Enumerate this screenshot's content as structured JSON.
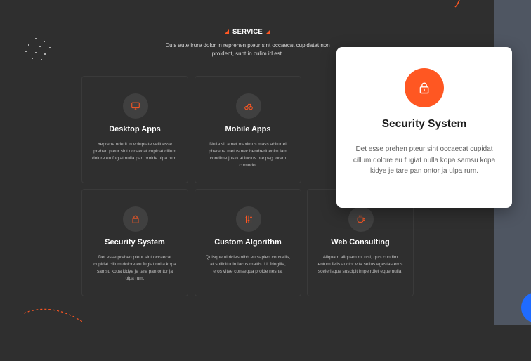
{
  "section": {
    "tag": "SERVICE",
    "intro": "Duis aute irure dolor in reprehen pteur sint occaecat cupidatat non proident, sunt in culim id est."
  },
  "cards": [
    {
      "title": "Desktop Apps",
      "icon": "monitor-icon",
      "desc": "Yeprehe nderit in voluptate velit esse prehen pteur sint occaecat cupidat cillum dolore eu fugiat nulla pan proide ulpa rum."
    },
    {
      "title": "Mobile Apps",
      "icon": "mobile-icon",
      "desc": "Nulla sit amet maximus mass abitur el pharetra metus nec hendrerit enim iam condime justo at luctus ore pag torem comodo."
    },
    {
      "title": "Security System",
      "icon": "lock-icon",
      "desc": "Det esse prehen pteur sint occaecat cupidat cillum dolore eu fugiat nulla kopa samsu kopa kidye je tare pan ontor ja ulpa rum."
    },
    {
      "title": "Custom Algorithm",
      "icon": "sliders-icon",
      "desc": "Quisque ultricies nibh eu sapien convallis, at sollicitudin lacus mattis. Ut fringilla, eros vitae consequa proide nesha."
    },
    {
      "title": "Web Consulting",
      "icon": "coffee-icon",
      "desc": "Aliquam aliquam mi nisl, quis condim entum felis auctor vita sellus egestas eros scelerisque suscipit impe rdiet eque nulla."
    }
  ],
  "popup": {
    "title": "Security System",
    "icon": "lock-icon",
    "desc": "Det esse prehen pteur sint occaecat cupidat cillum dolore eu fugiat nulla kopa samsu kopa kidye je tare pan ontor ja ulpa rum."
  },
  "colors": {
    "accent": "#ff5722",
    "background": "#2f2f2f",
    "card_icon_bg": "#404040",
    "fab": "#1f6bff"
  }
}
